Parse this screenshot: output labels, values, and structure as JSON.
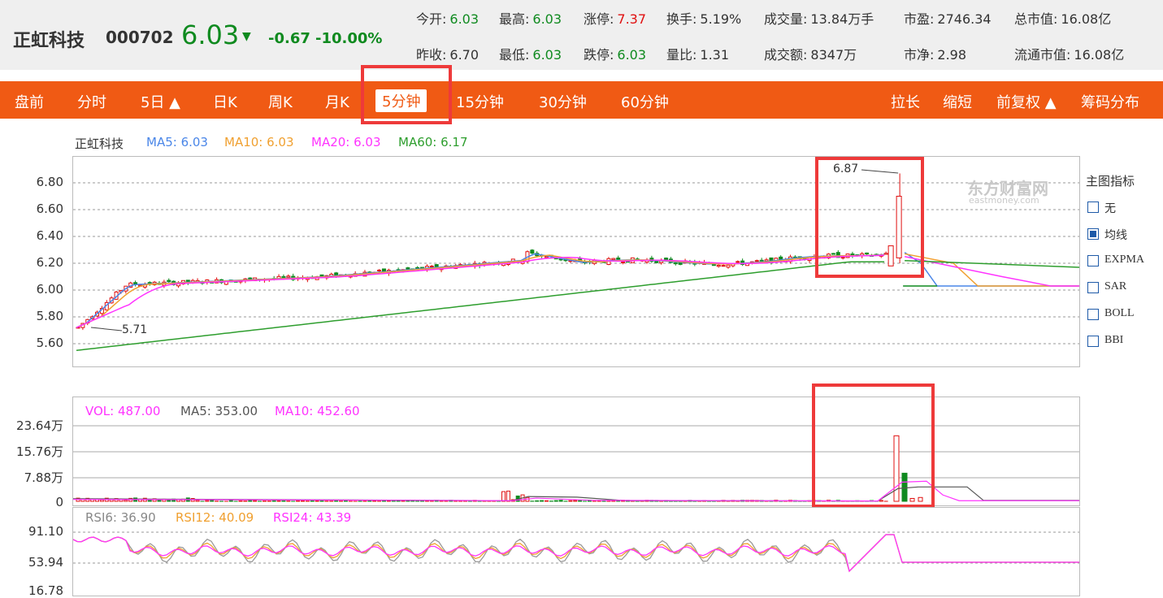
{
  "stock": {
    "name": "正虹科技",
    "code": "000702",
    "price": "6.03",
    "change": "-0.67",
    "change_pct": "-10.00%",
    "arrow": "▼"
  },
  "quote": {
    "row1": [
      {
        "label": "今开:",
        "value": "6.03",
        "color": "g"
      },
      {
        "label": "最高:",
        "value": "6.03",
        "color": "g"
      },
      {
        "label": "涨停:",
        "value": "7.37",
        "color": "r"
      },
      {
        "label": "换手:",
        "value": "5.19%",
        "color": "k"
      },
      {
        "label": "成交量:",
        "value": "13.84万手",
        "color": "k"
      },
      {
        "label": "市盈:",
        "value": "2746.34",
        "color": "k"
      },
      {
        "label": "总市值:",
        "value": "16.08亿",
        "color": "k"
      }
    ],
    "row2": [
      {
        "label": "昨收:",
        "value": "6.70",
        "color": "k"
      },
      {
        "label": "最低:",
        "value": "6.03",
        "color": "g"
      },
      {
        "label": "跌停:",
        "value": "6.03",
        "color": "g"
      },
      {
        "label": "量比:",
        "value": "1.31",
        "color": "k"
      },
      {
        "label": "成交额:",
        "value": "8347万",
        "color": "k"
      },
      {
        "label": "市净:",
        "value": "2.98",
        "color": "k"
      },
      {
        "label": "流通市值:",
        "value": "16.08亿",
        "color": "k"
      }
    ]
  },
  "tabs": [
    "盘前",
    "分时",
    "5日 ▲",
    "日K",
    "周K",
    "月K",
    "5分钟",
    "15分钟",
    "30分钟",
    "60分钟"
  ],
  "active_tab": "5分钟",
  "right_tabs": [
    "拉长",
    "缩短",
    "前复权 ▲",
    "筹码分布"
  ],
  "main_legend": {
    "name": "正虹科技",
    "ma5": "MA5: 6.03",
    "ma10": "MA10: 6.03",
    "ma20": "MA20: 6.03",
    "ma60": "MA60: 6.17"
  },
  "main_axis": [
    "6.80",
    "6.60",
    "6.40",
    "6.20",
    "6.00",
    "5.80",
    "5.60"
  ],
  "annotations": {
    "high": "6.87",
    "low": "5.71"
  },
  "watermark": {
    "cn": "东方财富网",
    "en": "eastmoney.com"
  },
  "indicator_panel": {
    "title": "主图指标",
    "options": [
      {
        "label": "无",
        "checked": false
      },
      {
        "label": "均线",
        "checked": true
      },
      {
        "label": "EXPMA",
        "checked": false
      },
      {
        "label": "SAR",
        "checked": false
      },
      {
        "label": "BOLL",
        "checked": false
      },
      {
        "label": "BBI",
        "checked": false
      }
    ]
  },
  "vol_legend": {
    "vol": "VOL: 487.00",
    "ma5": "MA5: 353.00",
    "ma10": "MA10: 452.60"
  },
  "vol_axis": [
    "23.64万",
    "15.76万",
    "7.88万",
    "0"
  ],
  "rsi_legend": {
    "rsi6": "RSI6: 36.90",
    "rsi12": "RSI12: 40.09",
    "rsi24": "RSI24: 43.39"
  },
  "rsi_axis": [
    "91.10",
    "53.94",
    "16.78"
  ],
  "colors": {
    "up": "#e01010",
    "down": "#0f8a1f",
    "ma5": "#4a86e8",
    "ma10": "#f0a030",
    "ma20": "#ff33ff",
    "ma60": "#2e9e2e",
    "bar": "#f05a14"
  }
}
